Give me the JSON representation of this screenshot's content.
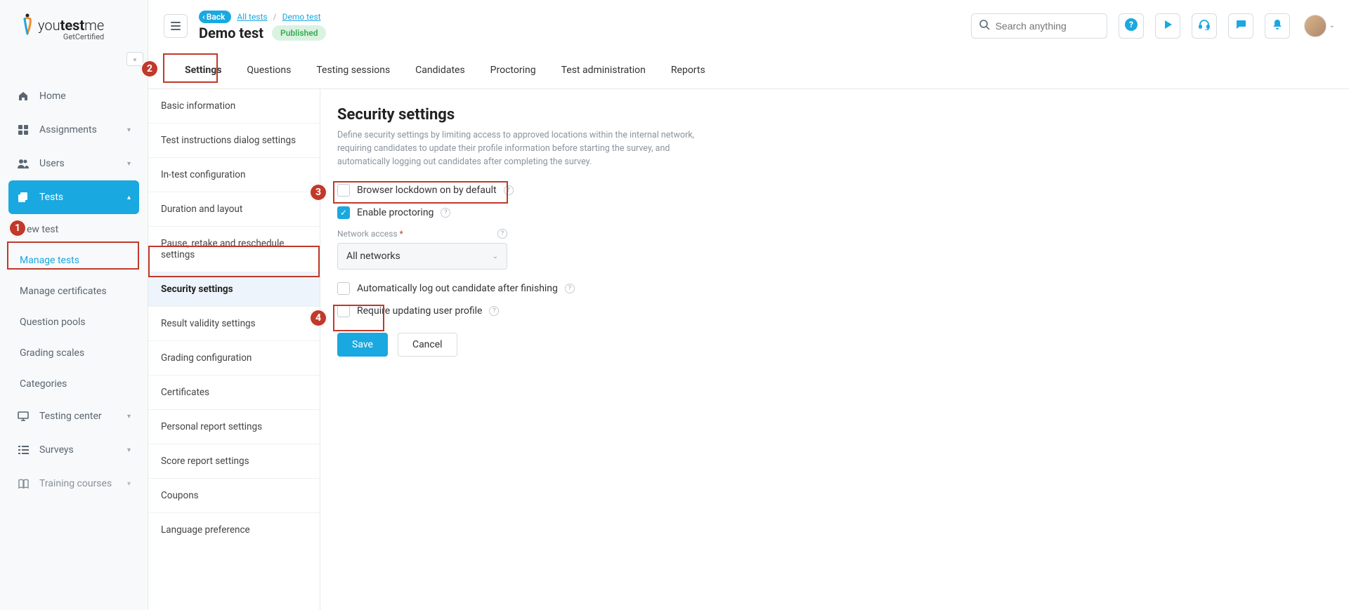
{
  "brand": {
    "name_light": "you",
    "name_bold1": "test",
    "name_bold2": "me",
    "subtitle": "GetCertified"
  },
  "sidebar": {
    "items": [
      {
        "label": "Home"
      },
      {
        "label": "Assignments"
      },
      {
        "label": "Users"
      },
      {
        "label": "Tests"
      }
    ],
    "tests_sub": [
      {
        "label": "New test"
      },
      {
        "label": "Manage tests"
      },
      {
        "label": "Manage certificates"
      },
      {
        "label": "Question pools"
      },
      {
        "label": "Grading scales"
      },
      {
        "label": "Categories"
      }
    ],
    "tail": [
      {
        "label": "Testing center"
      },
      {
        "label": "Surveys"
      },
      {
        "label": "Training courses"
      }
    ]
  },
  "header": {
    "back": "Back",
    "breadcrumb": {
      "a": "All tests",
      "b": "Demo test"
    },
    "title": "Demo test",
    "status": "Published",
    "search_placeholder": "Search anything",
    "icons": {
      "help": "help-icon",
      "play": "play-icon",
      "support": "headset-icon",
      "chat": "chat-icon",
      "bell": "bell-icon"
    }
  },
  "tabs": [
    {
      "label": "Settings",
      "active": true
    },
    {
      "label": "Questions"
    },
    {
      "label": "Testing sessions"
    },
    {
      "label": "Candidates"
    },
    {
      "label": "Proctoring"
    },
    {
      "label": "Test administration"
    },
    {
      "label": "Reports"
    }
  ],
  "settings_nav": [
    {
      "label": "Basic information"
    },
    {
      "label": "Test instructions dialog settings"
    },
    {
      "label": "In-test configuration"
    },
    {
      "label": "Duration and layout"
    },
    {
      "label": "Pause, retake and reschedule settings"
    },
    {
      "label": "Security settings",
      "active": true
    },
    {
      "label": "Result validity settings"
    },
    {
      "label": "Grading configuration"
    },
    {
      "label": "Certificates"
    },
    {
      "label": "Personal report settings"
    },
    {
      "label": "Score report settings"
    },
    {
      "label": "Coupons"
    },
    {
      "label": "Language preference"
    }
  ],
  "panel": {
    "title": "Security settings",
    "desc": "Define security settings by limiting access to approved locations within the internal network, requiring candidates to update their profile information before starting the survey, and automatically logging out candidates after completing the survey.",
    "fields": {
      "browser_lockdown": "Browser lockdown on by default",
      "enable_proctoring": "Enable proctoring",
      "network_access_label": "Network access",
      "network_access_value": "All networks",
      "auto_logout": "Automatically log out candidate after finishing",
      "require_profile": "Require updating user profile"
    },
    "buttons": {
      "save": "Save",
      "cancel": "Cancel"
    }
  },
  "callouts": {
    "n1": "1",
    "n2": "2",
    "n3": "3",
    "n4": "4"
  }
}
